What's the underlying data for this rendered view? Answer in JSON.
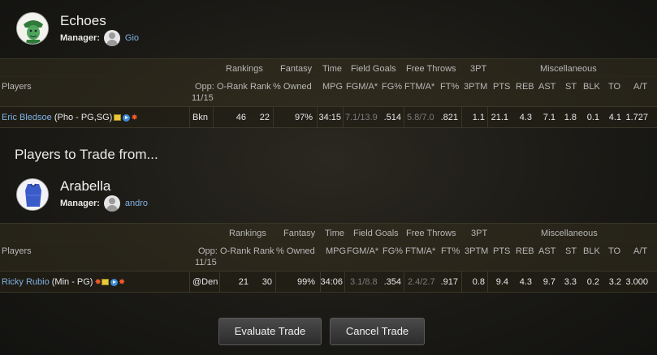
{
  "teams": [
    {
      "name": "Echoes",
      "manager_label": "Manager:",
      "manager": "Gio",
      "logo": "green-cartoon-logo-icon"
    },
    {
      "name": "Arabella",
      "manager_label": "Manager:",
      "manager": "andro",
      "logo": "blue-jersey-logo-icon"
    }
  ],
  "section_title": "Players to Trade from...",
  "column_groups": {
    "rankings": "Rankings",
    "fantasy": "Fantasy",
    "time": "Time",
    "field_goals": "Field Goals",
    "free_throws": "Free Throws",
    "three_pt": "3PT",
    "misc": "Miscellaneous"
  },
  "columns": {
    "players": "Players",
    "opp_line1": "Opp:",
    "opp_line2": "11/15",
    "orank": "O-Rank",
    "rank": "Rank",
    "owned": "% Owned",
    "mpg": "MPG",
    "fgma": "FGM/A*",
    "fgpct": "FG%",
    "ftma": "FTM/A*",
    "ftpct": "FT%",
    "tpm": "3PTM",
    "pts": "PTS",
    "reb": "REB",
    "ast": "AST",
    "st": "ST",
    "blk": "BLK",
    "to": "TO",
    "ato": "A/T"
  },
  "players": [
    {
      "name": "Eric Bledsoe",
      "info": "(Pho - PG,SG)",
      "opp": "Bkn",
      "orank": "46",
      "rank": "22",
      "owned": "97%",
      "mpg": "34:15",
      "fgma": "7.1/13.9",
      "fgpct": ".514",
      "ftma": "5.8/7.0",
      "ftpct": ".821",
      "tpm": "1.1",
      "pts": "21.1",
      "reb": "4.3",
      "ast": "7.1",
      "st": "1.8",
      "blk": "0.1",
      "to": "4.1",
      "ato": "1.727"
    },
    {
      "name": "Ricky Rubio",
      "info": "(Min - PG)",
      "opp": "@Den",
      "orank": "21",
      "rank": "30",
      "owned": "99%",
      "mpg": "34:06",
      "fgma": "3.1/8.8",
      "fgpct": ".354",
      "ftma": "2.4/2.7",
      "ftpct": ".917",
      "tpm": "0.8",
      "pts": "9.4",
      "reb": "4.3",
      "ast": "9.7",
      "st": "3.3",
      "blk": "0.2",
      "to": "3.2",
      "ato": "3.000"
    }
  ],
  "buttons": {
    "evaluate": "Evaluate Trade",
    "cancel": "Cancel Trade"
  },
  "colors": {
    "link": "#7fb2e5",
    "background": "#1b1a16",
    "note_icon": "#e8c83a",
    "play_icon": "#3d8bd8",
    "burst_icon": "#ee5a2a"
  }
}
